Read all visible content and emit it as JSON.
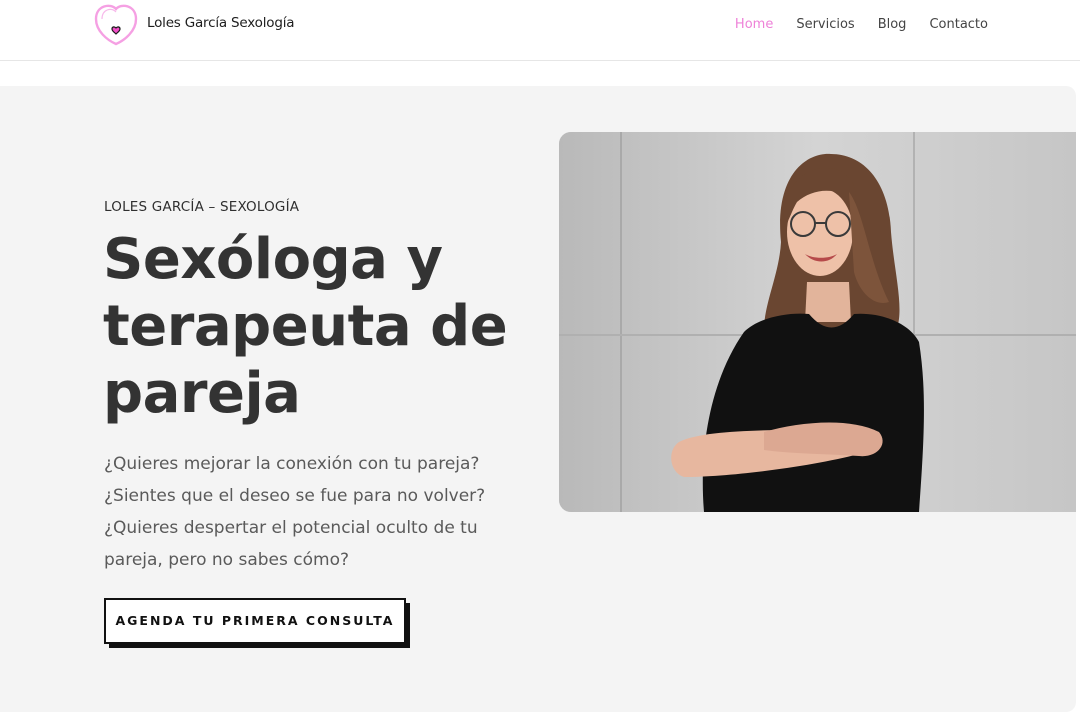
{
  "header": {
    "brand": "Loles García Sexología",
    "nav": [
      {
        "label": "Home",
        "active": true
      },
      {
        "label": "Servicios",
        "active": false
      },
      {
        "label": "Blog",
        "active": false
      },
      {
        "label": "Contacto",
        "active": false
      }
    ]
  },
  "hero": {
    "eyebrow": "LOLES GARCÍA – SEXOLOGÍA",
    "title_lines": [
      "Sexóloga y",
      "terapeuta de",
      "pareja"
    ],
    "lead_lines": [
      "¿Quieres mejorar la conexión con tu pareja?",
      "¿Sientes que el deseo se fue para no volver?",
      "¿Quieres despertar el potencial oculto de tu",
      "pareja, pero no sabes cómo?"
    ],
    "cta_label": "AGENDA TU PRIMERA CONSULTA"
  },
  "colors": {
    "accent": "#ee82d8",
    "logo_heart": "#f24fc8",
    "text": "#333333",
    "hero_bg": "#f4f4f4"
  }
}
